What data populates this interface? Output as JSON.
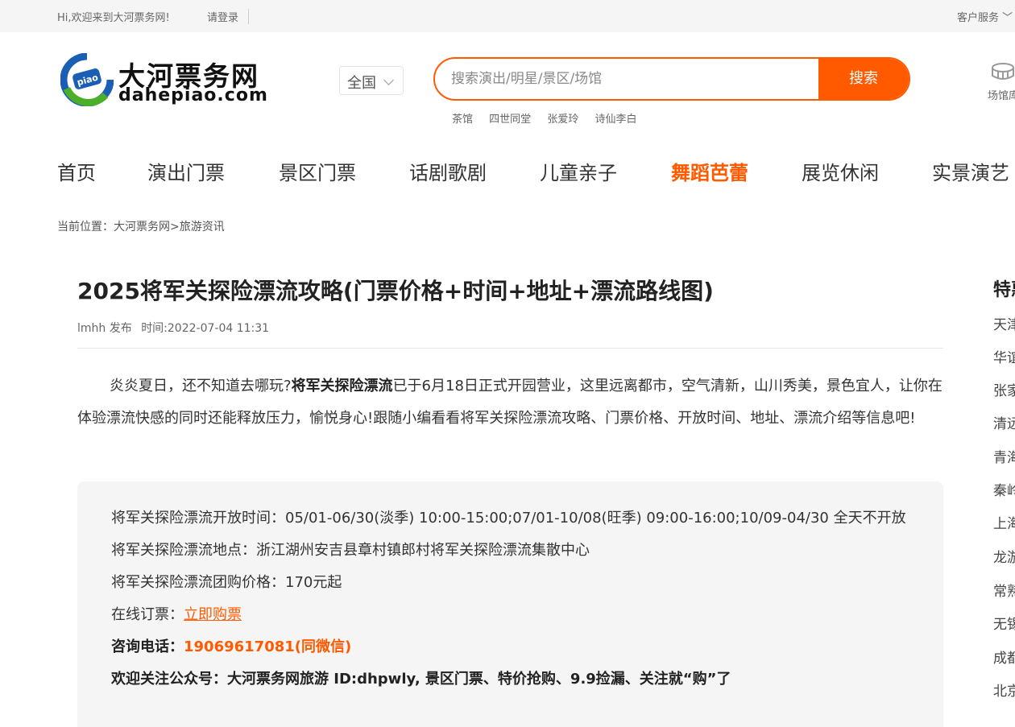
{
  "topbar": {
    "welcome": "Hi,欢迎来到大河票务网!",
    "login": "请登录",
    "customer_service": "客户服务 ﹀"
  },
  "logo": {
    "cn": "大河票务网",
    "en": "dahepiao.com",
    "badge": "piao"
  },
  "city": {
    "selected": "全国"
  },
  "search": {
    "placeholder": "搜索演出/明星/景区/场馆",
    "button": "搜索",
    "hotwords": [
      "茶馆",
      "四世同堂",
      "张爱玲",
      "诗仙李白"
    ]
  },
  "venue": {
    "label": "场馆库"
  },
  "nav": {
    "items": [
      "首页",
      "演出门票",
      "景区门票",
      "话剧歌剧",
      "儿童亲子",
      "舞蹈芭蕾",
      "展览休闲",
      "实景演艺"
    ],
    "active_index": 5
  },
  "breadcrumb": "当前位置：大河票务网>旅游资讯",
  "article": {
    "title": "2025将军关探险漂流攻略(门票价格+时间+地址+漂流路线图)",
    "author": "lmhh 发布",
    "time": "时间:2022-07-04 11:31",
    "intro_before": "炎炎夏日，还不知道去哪玩?",
    "intro_bold": "将军关探险漂流",
    "intro_after": "已于6月18日正式开园营业，这里远离都市，空气清新，山川秀美，景色宜人，让你在体验漂流快感的同时还能释放压力，愉悦身心!跟随小编看看将军关探险漂流攻略、门票价格、开放时间、地址、漂流介绍等信息吧!",
    "info": {
      "open_time": "将军关探险漂流开放时间：05/01-06/30(淡季) 10:00-15:00;07/01-10/08(旺季) 09:00-16:00;10/09-04/30 全天不开放",
      "address": "将军关探险漂流地点：浙江湖州安吉县章村镇郎村将军关探险漂流集散中心",
      "price": "将军关探险漂流团购价格：170元起",
      "online_label": "在线订票：",
      "online_link": "立即购票",
      "phone_label": "咨询电话：",
      "phone": "19069617081(同微信)",
      "wechat": "欢迎关注公众号：大河票务网旅游 ID:dhpwly, 景区门票、特价抢购、9.9捡漏、关注就“购”了"
    }
  },
  "sidebar": {
    "title": "特惠",
    "items": [
      "天津",
      "华谊",
      "张家",
      "清远",
      "青海",
      "秦岭",
      "上海",
      "龙游",
      "常熟",
      "无锡",
      "成都",
      "北京"
    ]
  },
  "colors": {
    "accent": "#ff5a00",
    "logo_blue": "#1a5fb4",
    "logo_green": "#4caf2a"
  }
}
